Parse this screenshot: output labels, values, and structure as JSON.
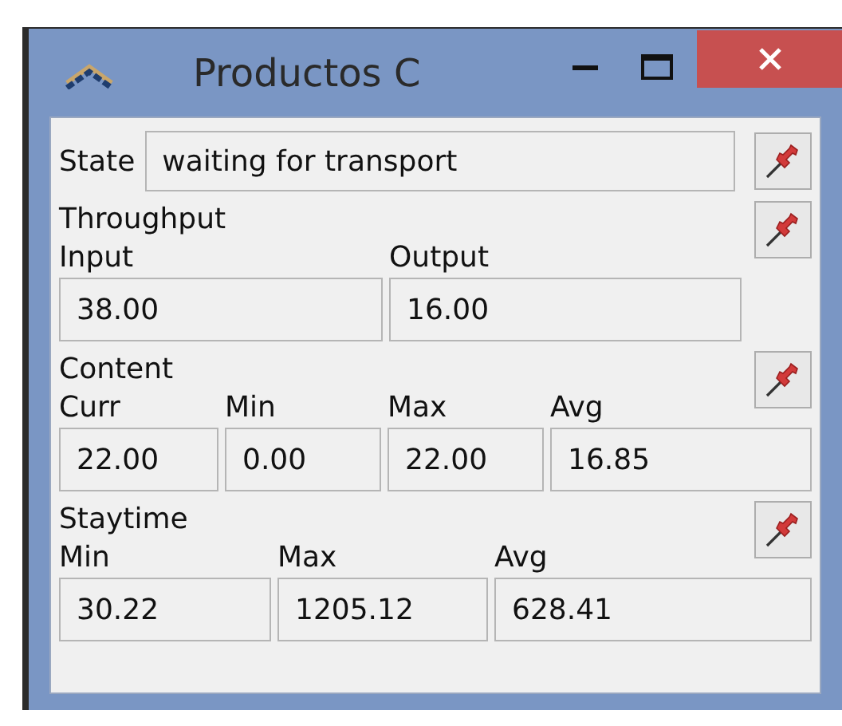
{
  "window": {
    "title": "Productos C"
  },
  "state": {
    "label": "State",
    "value": "waiting for transport"
  },
  "sections": [
    {
      "title": "Throughput",
      "columns": [
        {
          "label": "Input",
          "value": "38.00"
        },
        {
          "label": "Output",
          "value": "16.00"
        }
      ]
    },
    {
      "title": "Content",
      "columns": [
        {
          "label": "Curr",
          "value": "22.00"
        },
        {
          "label": "Min",
          "value": "0.00"
        },
        {
          "label": "Max",
          "value": "22.00"
        },
        {
          "label": "Avg",
          "value": "16.85"
        }
      ]
    },
    {
      "title": "Staytime",
      "columns": [
        {
          "label": "Min",
          "value": "30.22"
        },
        {
          "label": "Max",
          "value": "1205.12"
        },
        {
          "label": "Avg",
          "value": "628.41"
        }
      ]
    }
  ]
}
